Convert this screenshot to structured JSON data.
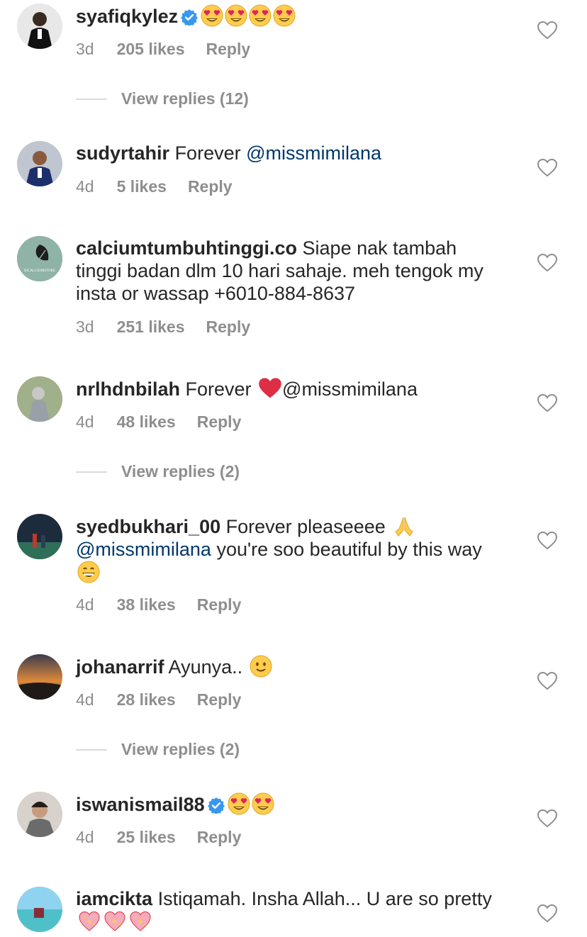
{
  "colors": {
    "text": "#262626",
    "meta": "#8e8e8e",
    "mention": "#00376b",
    "verified": "#3897f0"
  },
  "comments": [
    {
      "username": "syafiqkylez",
      "verified": true,
      "text": "",
      "emojis": [
        "heart-eyes",
        "heart-eyes",
        "heart-eyes",
        "heart-eyes"
      ],
      "time": "3d",
      "likes": "205 likes",
      "reply": "Reply",
      "view_replies": "View replies (12)"
    },
    {
      "username": "sudyrtahir",
      "text_before": "Forever ",
      "mention": "@missmimilana",
      "time": "4d",
      "likes": "5 likes",
      "reply": "Reply"
    },
    {
      "username": "calciumtumbuhtinggi.co",
      "text_before": "Siape nak tambah tinggi badan dlm 10 hari sahaje. meh tengok my insta or wassap +6010-884-8637",
      "time": "3d",
      "likes": "251 likes",
      "reply": "Reply",
      "avatar_text": "BICALCIUMSTORE"
    },
    {
      "username": "nrlhdnbilah",
      "text_before": "Forever ",
      "emoji_mid": "red-heart",
      "mention": "@missmimilana",
      "time": "4d",
      "likes": "48 likes",
      "reply": "Reply",
      "view_replies": "View replies (2)"
    },
    {
      "username": "syedbukhari_00",
      "text_before": "Forever pleaseeee ",
      "mention": "@missmimilana",
      "text_after": " you're soo beautiful by this way ",
      "time": "4d",
      "likes": "38 likes",
      "reply": "Reply"
    },
    {
      "username": "johanarrif",
      "text_before": "Ayunya.. ",
      "time": "4d",
      "likes": "28 likes",
      "reply": "Reply",
      "view_replies": "View replies (2)"
    },
    {
      "username": "iswanismail88",
      "verified": true,
      "time": "4d",
      "likes": "25 likes",
      "reply": "Reply"
    },
    {
      "username": "iamcikta",
      "text_before": "Istiqamah. Insha Allah... U are so pretty "
    }
  ]
}
